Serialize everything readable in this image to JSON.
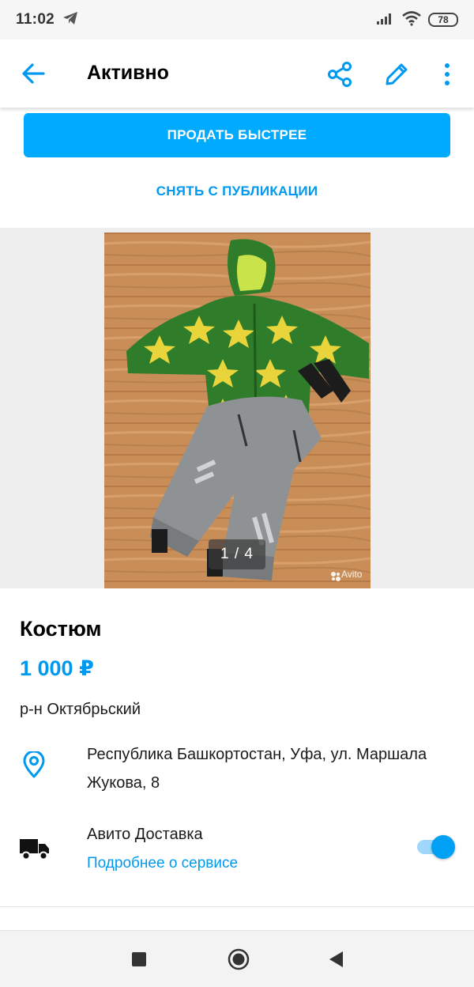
{
  "status_bar": {
    "time": "11:02",
    "battery": "78",
    "icons": [
      "telegram-icon",
      "signal-icon",
      "wifi-icon",
      "battery-icon"
    ]
  },
  "toolbar": {
    "title": "Активно",
    "icons": [
      "back-arrow-icon",
      "share-icon",
      "edit-icon",
      "more-vert-icon"
    ]
  },
  "actions": {
    "sell_faster": "ПРОДАТЬ БЫСТРЕЕ",
    "unpublish": "СНЯТЬ С ПУБЛИКАЦИИ"
  },
  "gallery": {
    "counter": "1 / 4",
    "watermark": "Avito"
  },
  "item": {
    "title": "Костюм",
    "price": "1 000 ₽",
    "district": "р-н Октябрьский",
    "address": "Республика Башкортостан, Уфа, ул. Маршала Жукова, 8"
  },
  "delivery": {
    "title": "Авито Доставка",
    "link": "Подробнее о сервисе",
    "enabled": true
  },
  "colors": {
    "accent": "#00aaff",
    "link": "#0099f0",
    "text": "#000000"
  },
  "nav_bar": {
    "icons": [
      "recents-icon",
      "home-icon",
      "back-icon"
    ]
  }
}
